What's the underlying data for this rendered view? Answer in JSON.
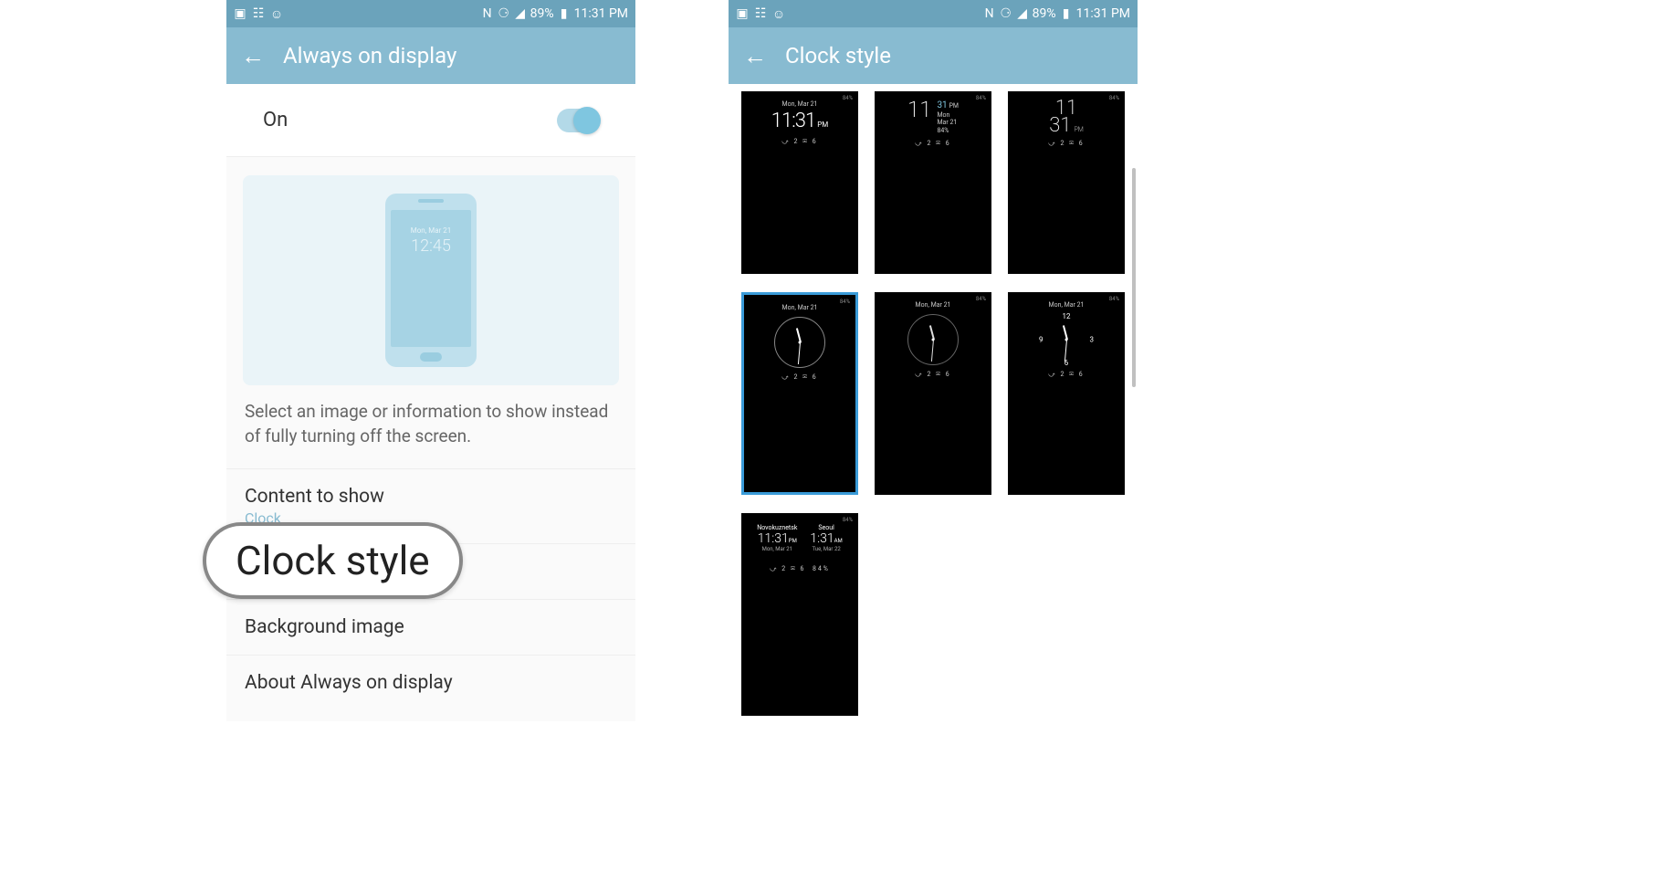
{
  "status": {
    "battery": "89%",
    "time": "11:31 PM",
    "nfc": "N"
  },
  "left": {
    "title": "Always on display",
    "toggle_label": "On",
    "mockup_date": "Mon, Mar 21",
    "mockup_time": "12:45",
    "description": "Select an image or information to show instead of fully turning off the screen.",
    "items": {
      "content": {
        "title": "Content to show",
        "sub": "Clock"
      },
      "clock_style": {
        "title": "Clock style"
      },
      "background": {
        "title": "Background image"
      },
      "about": {
        "title": "About Always on display"
      }
    }
  },
  "right": {
    "title": "Clock style",
    "cards": {
      "date": "Mon, Mar 21",
      "battery_top": "84%",
      "digital1": {
        "time": "11:31",
        "ampm": "PM"
      },
      "digital2": {
        "hour": "11",
        "day": "31",
        "ampm": "PM",
        "dow": "Mon",
        "mon": "Mar 21"
      },
      "digital3": {
        "hour": "11",
        "min": "31",
        "ampm": "PM"
      },
      "world": {
        "city1": "Novokuznetsk",
        "time1": "11:31",
        "ampm1": "PM",
        "date1": "Mon, Mar 21",
        "city2": "Seoul",
        "time2": "1:31",
        "ampm2": "AM",
        "date2": "Tue, Mar 22"
      },
      "notif": "⤻ 2   ✉ 6",
      "bottom_bat": "84%"
    }
  },
  "callout": "Clock style"
}
